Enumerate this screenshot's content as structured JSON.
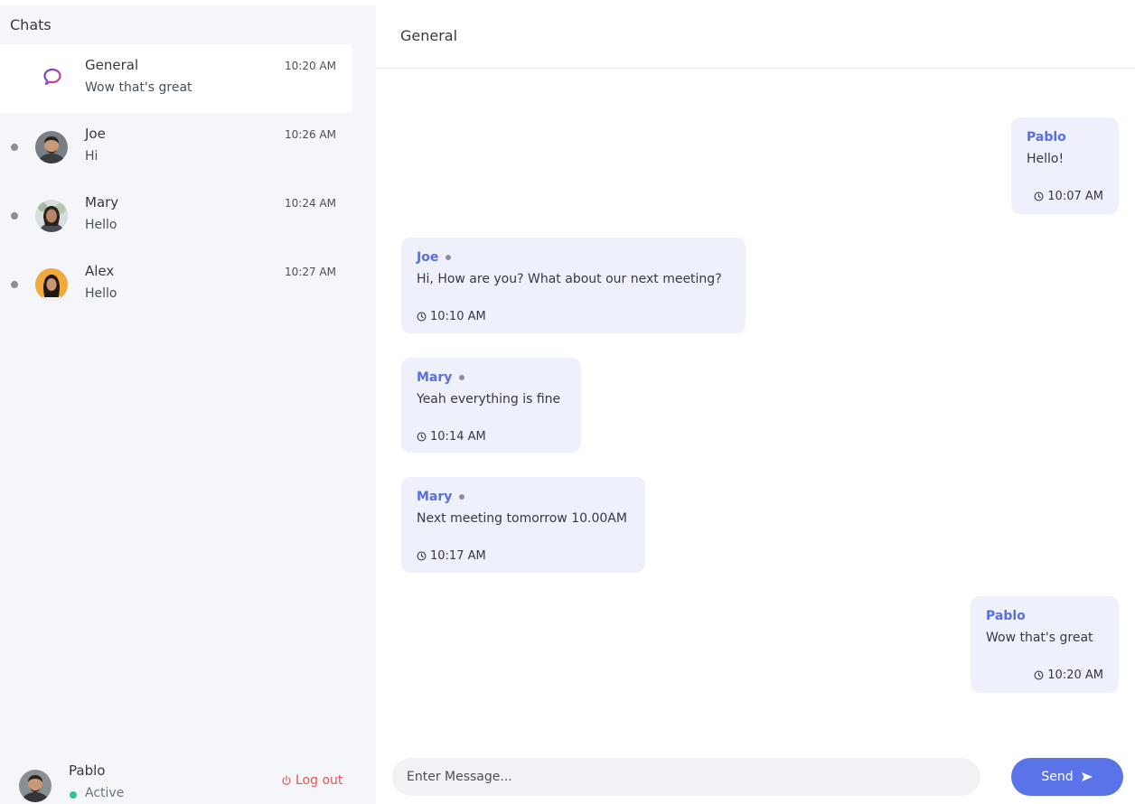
{
  "sidebar": {
    "title": "Chats",
    "chats": [
      {
        "name": "General",
        "preview": "Wow that's great",
        "time": "10:20 AM",
        "active": true
      },
      {
        "name": "Joe",
        "preview": "Hi",
        "time": "10:26 AM"
      },
      {
        "name": "Mary",
        "preview": "Hello",
        "time": "10:24 AM"
      },
      {
        "name": "Alex",
        "preview": "Hello",
        "time": "10:27 AM"
      }
    ],
    "profile": {
      "name": "Pablo",
      "status": "Active",
      "logout_label": "Log out"
    }
  },
  "main": {
    "title": "General",
    "messages": [
      {
        "sender": "Pablo",
        "text": "Hello!",
        "time": "10:07 AM",
        "side": "right"
      },
      {
        "sender": "Joe",
        "text": "Hi, How are you? What about our next meeting?",
        "time": "10:10 AM",
        "side": "left"
      },
      {
        "sender": "Mary",
        "text": "Yeah everything is fine",
        "time": "10:14 AM",
        "side": "left"
      },
      {
        "sender": "Mary",
        "text": "Next meeting tomorrow 10.00AM",
        "time": "10:17 AM",
        "side": "left"
      },
      {
        "sender": "Pablo",
        "text": "Wow that's great",
        "time": "10:20 AM",
        "side": "right"
      }
    ],
    "composer": {
      "placeholder": "Enter Message...",
      "send_label": "Send"
    }
  },
  "colors": {
    "accent": "#5b73e8",
    "sender_name": "#5870e0",
    "bubble_bg": "#eef0fb",
    "sidebar_bg": "#f5f6fa",
    "online": "#34c38f",
    "logout": "#e55353"
  },
  "icons": {
    "general_chat": "chat-bubble-icon",
    "time": "clock-icon",
    "logout": "power-icon",
    "send": "send-arrow-icon"
  }
}
